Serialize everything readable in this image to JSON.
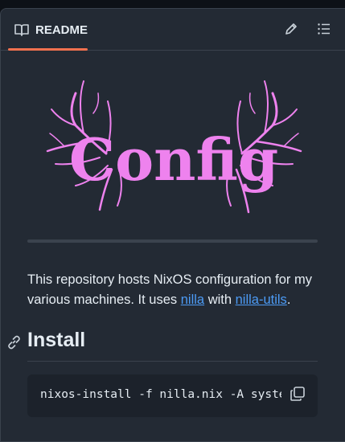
{
  "tabbar": {
    "tab_label": "README",
    "tab_icon": "book-icon",
    "edit_icon": "pencil-icon",
    "outline_icon": "list-icon",
    "accent_color": "#f2714f"
  },
  "hero": {
    "logo_text": "Config",
    "logo_color": "#ee82ee"
  },
  "intro": {
    "text_before": "This repository hosts NixOS configuration for my various machines. It uses ",
    "link1": "nilla",
    "text_middle": " with ",
    "link2": "nilla-utils",
    "text_after": ".",
    "link_color": "#4c9bf5"
  },
  "install": {
    "heading": "Install",
    "anchor_icon": "link-icon",
    "command": "nixos-install -f nilla.nix -A systems.nixos.<name>",
    "copy_icon": "copy-icon"
  }
}
